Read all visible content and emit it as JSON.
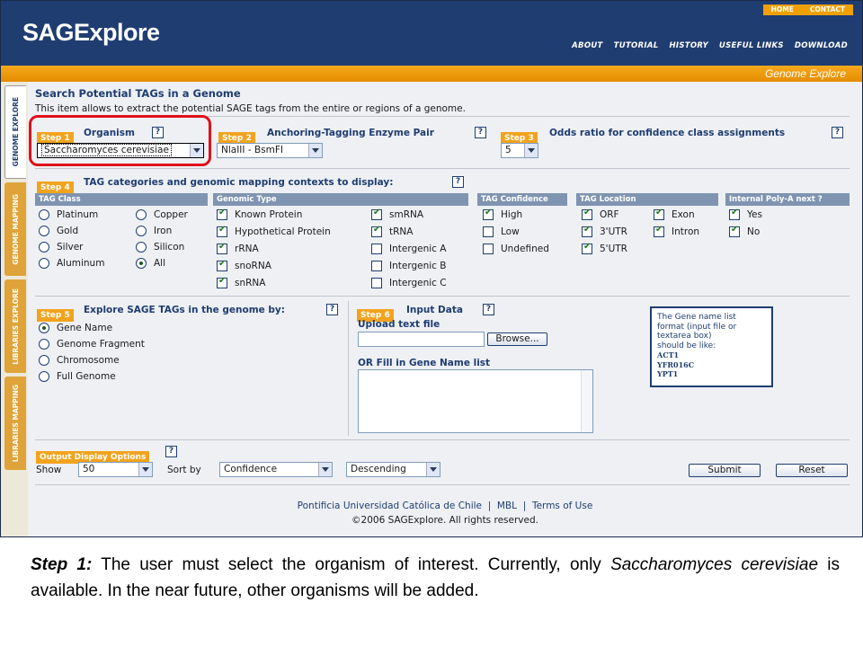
{
  "header": {
    "logo": "SAGExplore",
    "top_links": [
      "HOME",
      "CONTACT"
    ],
    "nav": [
      "ABOUT",
      "TUTORIAL",
      "HISTORY",
      "USEFUL LINKS",
      "DOWNLOAD"
    ],
    "section_title": "Genome Explore"
  },
  "side_tabs": [
    "GENOME EXPLORE",
    "GENOME MAPPING",
    "LIBRARIES EXPLORE",
    "LIBRARIES MAPPING"
  ],
  "page": {
    "title": "Search Potential TAGs in a Genome",
    "description": "This item allows to extract the potential SAGE tags from the entire or regions of a genome."
  },
  "step1": {
    "badge": "Step 1",
    "label": "Organism",
    "value": "Saccharomyces cerevisiae"
  },
  "step2": {
    "badge": "Step 2",
    "label": "Anchoring-Tagging Enzyme Pair",
    "value": "NlaIII - BsmFI"
  },
  "step3": {
    "badge": "Step 3",
    "label": "Odds ratio for confidence class assignments",
    "value": "5"
  },
  "step4": {
    "badge": "Step 4",
    "label": "TAG categories and genomic mapping contexts to display:",
    "tag_class": {
      "header": "TAG Class",
      "options": [
        "Platinum",
        "Copper",
        "Gold",
        "Iron",
        "Silver",
        "Silicon",
        "Aluminum",
        "All"
      ],
      "selected": "All"
    },
    "genomic_type": {
      "header": "Genomic Type",
      "options": [
        "Known Protein",
        "smRNA",
        "Hypothetical Protein",
        "tRNA",
        "rRNA",
        "Intergenic A",
        "snoRNA",
        "Intergenic B",
        "snRNA",
        "Intergenic C"
      ]
    },
    "tag_confidence": {
      "header": "TAG Confidence",
      "options": [
        "High",
        "Low",
        "Undefined"
      ]
    },
    "tag_location": {
      "header": "TAG Location",
      "options": [
        "ORF",
        "Exon",
        "3'UTR",
        "Intron",
        "5'UTR"
      ]
    },
    "polya": {
      "header": "Internal Poly-A next ?",
      "options": [
        "Yes",
        "No"
      ]
    }
  },
  "step5": {
    "badge": "Step 5",
    "label": "Explore SAGE TAGs in the genome by:",
    "options": [
      "Gene Name",
      "Genome Fragment",
      "Chromosome",
      "Full Genome"
    ],
    "selected": "Gene Name"
  },
  "step6": {
    "badge": "Step 6",
    "label": "Input Data",
    "upload_label": "Upload text file",
    "browse": "Browse...",
    "fill_label": "OR Fill in Gene Name list",
    "hint_lines": [
      "The Gene name list",
      "format (input file or",
      "textarea box)",
      "should be like:",
      "ACT1",
      "YFR016C",
      "YPT1"
    ]
  },
  "output": {
    "badge": "Output Display Options",
    "show_label": "Show",
    "show_value": "50",
    "sort_label": "Sort by",
    "sort_value": "Confidence",
    "order_value": "Descending",
    "submit": "Submit",
    "reset": "Reset"
  },
  "footer": {
    "links": [
      "Pontificia Universidad Católica de Chile",
      "|",
      "MBL",
      "|",
      "Terms of Use"
    ],
    "copyright": "©2006 SAGExplore. All rights reserved."
  },
  "caption": {
    "lead": "Step 1:",
    "text1": " The user must select the organism of interest. Currently, only ",
    "organism": "Saccharomyces cerevisiae",
    "text2": " is available. In the near future, other organisms will be added."
  },
  "colors": {
    "header": "#1f3d70",
    "accent": "#f2a31e",
    "highlight": "#e0101a"
  }
}
